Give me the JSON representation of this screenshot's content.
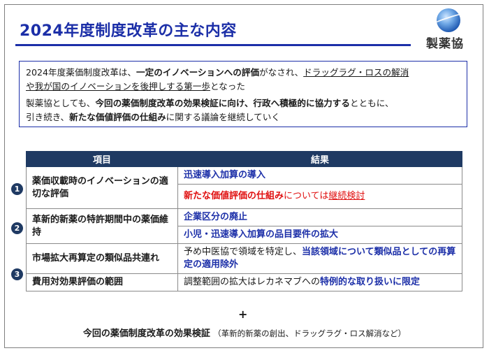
{
  "title": "2024年度制度改革の主な内容",
  "logo_text": "製薬協",
  "summary": {
    "line1": [
      {
        "t": "2024年度薬価制度改革は、",
        "s": ""
      },
      {
        "t": "一定のイノベーションへの評価",
        "s": "bold"
      },
      {
        "t": "がなされ、",
        "s": ""
      },
      {
        "t": "ドラッグラグ・ロスの解消",
        "s": "ul"
      }
    ],
    "line2": [
      {
        "t": "や我が国のイノベーションを後押しする第一歩",
        "s": "ul"
      },
      {
        "t": "となった",
        "s": ""
      }
    ],
    "line3": [
      {
        "t": "製薬協としても、",
        "s": ""
      },
      {
        "t": "今回の薬価制度改革の効果検証に向け、行政へ積極的に協力する",
        "s": "bold"
      },
      {
        "t": "とともに、",
        "s": ""
      }
    ],
    "line4": [
      {
        "t": "引き続き、",
        "s": ""
      },
      {
        "t": "新たな価値評価の仕組み",
        "s": "bold"
      },
      {
        "t": "に関する議論を継続していく",
        "s": ""
      }
    ]
  },
  "table": {
    "head_item": "項目",
    "head_result": "結果",
    "rows": [
      {
        "item": "薬価収載時のイノベーションの適切な評価",
        "r1a": "迅速導入加算の導入",
        "r2a": "新たな価値評価の仕組み",
        "r2b": "については",
        "r2c": "継続検討"
      },
      {
        "item": "革新的新薬の特許期間中の薬価維持",
        "r1": "企業区分の廃止",
        "r2": "小児・迅速導入加算の品目要件の拡大"
      },
      {
        "item": "市場拡大再算定の類似品共連れ",
        "pre": "予め中医協で領域を特定し、",
        "strong": "当該領域について類似品としての再算定の適用除外"
      },
      {
        "item": "費用対効果評価の範囲",
        "pre": "調整範囲の拡大はレカネマブへの",
        "strong": "特例的な取り扱いに限定"
      }
    ]
  },
  "markers": [
    "1",
    "2",
    "3"
  ],
  "plus": "+",
  "footer": {
    "main": "今回の薬価制度改革の効果検証",
    "sub": "（革新的新薬の創出、ドラッグラグ・ロス解消など）"
  }
}
